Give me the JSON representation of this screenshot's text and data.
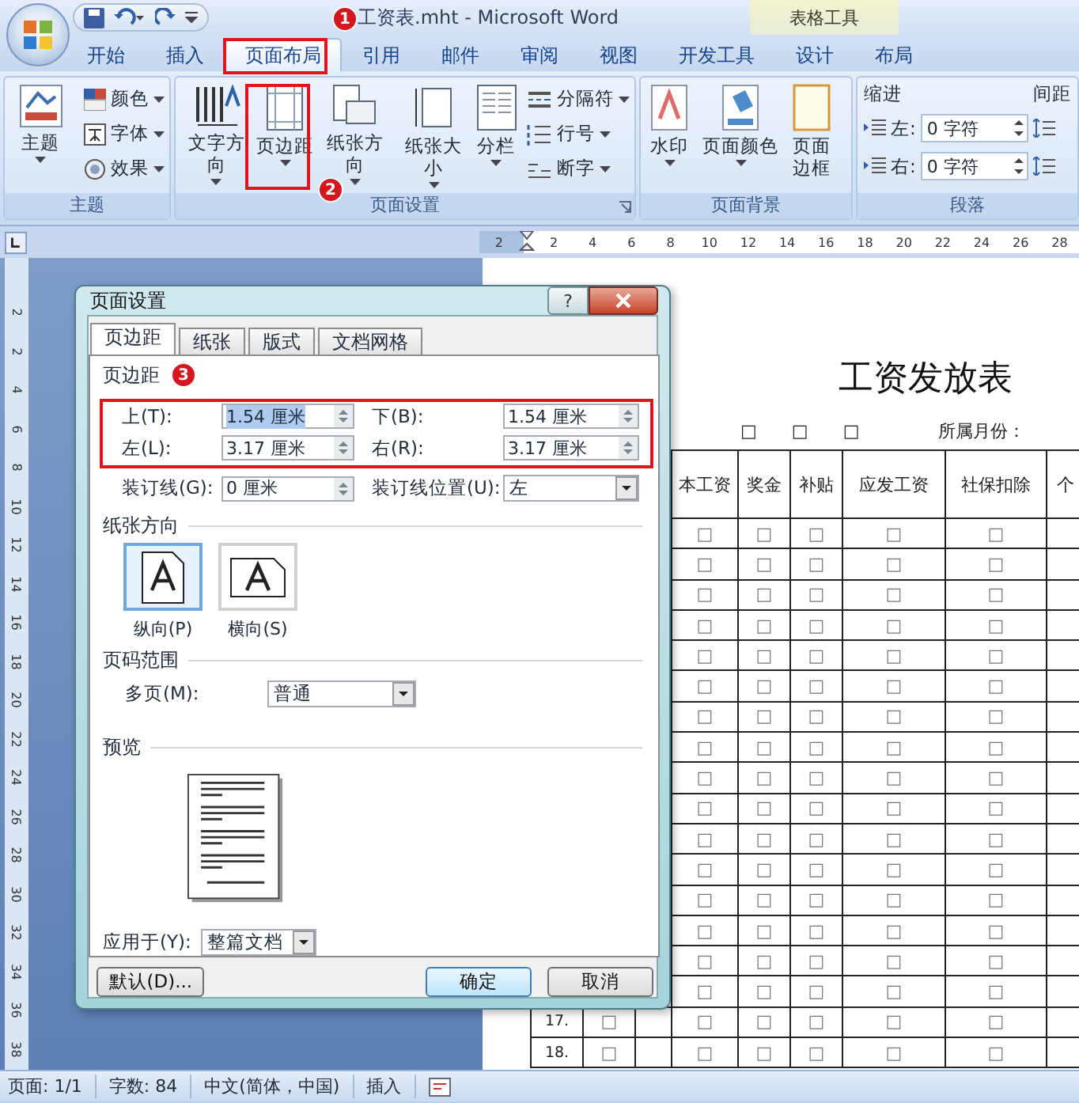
{
  "title_bar": {
    "title": "工资表.mht - Microsoft Word",
    "context_group": "表格工具"
  },
  "ribbon_tabs": [
    {
      "label": "开始",
      "selected": false
    },
    {
      "label": "插入",
      "selected": false
    },
    {
      "label": "页面布局",
      "selected": true
    },
    {
      "label": "引用",
      "selected": false
    },
    {
      "label": "邮件",
      "selected": false
    },
    {
      "label": "审阅",
      "selected": false
    },
    {
      "label": "视图",
      "selected": false
    },
    {
      "label": "开发工具",
      "selected": false
    },
    {
      "label": "设计",
      "selected": false
    },
    {
      "label": "布局",
      "selected": false
    }
  ],
  "ribbon_groups": [
    {
      "kind": "buttons",
      "title": "主题",
      "launcher": false,
      "large": [
        {
          "label": "主题",
          "dropdown": true
        }
      ],
      "small": [
        {
          "label": "颜色"
        },
        {
          "label": "字体"
        },
        {
          "label": "效果"
        }
      ]
    },
    {
      "kind": "buttons",
      "title": "页面设置",
      "launcher": true,
      "large": [
        {
          "label": "文字方向",
          "dropdown": true
        },
        {
          "label": "页边距",
          "dropdown": true
        },
        {
          "label": "纸张方向",
          "dropdown": true
        },
        {
          "label": "纸张大小",
          "dropdown": true
        },
        {
          "label": "分栏",
          "dropdown": true
        }
      ],
      "small": [
        {
          "label": "分隔符"
        },
        {
          "label": "行号"
        },
        {
          "label": "断字"
        }
      ]
    },
    {
      "kind": "buttons",
      "title": "页面背景",
      "launcher": false,
      "large": [
        {
          "label": "水印",
          "dropdown": true
        },
        {
          "label": "页面颜色",
          "dropdown": true
        },
        {
          "label": "页面边框",
          "dropdown": false
        }
      ]
    },
    {
      "kind": "paragraph",
      "title": "段落",
      "indent_label": "缩进",
      "indent_fields": [
        {
          "label": "左:",
          "value": "0 字符"
        },
        {
          "label": "右:",
          "value": "0 字符"
        }
      ],
      "spacing_label": "间距"
    }
  ],
  "ruler": {
    "marks": [
      "2",
      "2",
      "4",
      "6",
      "8",
      "10",
      "12",
      "14",
      "16",
      "18",
      "20",
      "22",
      "24",
      "26",
      "28"
    ]
  },
  "vertical_ruler": {
    "marks": [
      "2",
      "2",
      "4",
      "6",
      "8",
      "10",
      "12",
      "14",
      "16",
      "18",
      "20",
      "22",
      "24",
      "26",
      "28",
      "30",
      "32",
      "34",
      "36",
      "38"
    ]
  },
  "document": {
    "title": "工资发放表",
    "header_marks": [
      "□",
      "□",
      "□"
    ],
    "month_label": "所属月份：",
    "table": {
      "columns": [
        "本工资",
        "奖金",
        "补贴",
        "应发工资",
        "社保扣除",
        "个"
      ],
      "rows": [
        {
          "cells": [
            "□",
            "□",
            "□",
            "□",
            "□"
          ]
        },
        {
          "cells": [
            "□",
            "□",
            "□",
            "□",
            "□"
          ]
        },
        {
          "cells": [
            "□",
            "□",
            "□",
            "□",
            "□"
          ]
        },
        {
          "cells": [
            "□",
            "□",
            "□",
            "□",
            "□"
          ]
        },
        {
          "cells": [
            "□",
            "□",
            "□",
            "□",
            "□"
          ]
        },
        {
          "cells": [
            "□",
            "□",
            "□",
            "□",
            "□"
          ]
        },
        {
          "cells": [
            "□",
            "□",
            "□",
            "□",
            "□"
          ]
        },
        {
          "cells": [
            "□",
            "□",
            "□",
            "□",
            "□"
          ]
        },
        {
          "cells": [
            "□",
            "□",
            "□",
            "□",
            "□"
          ]
        },
        {
          "cells": [
            "□",
            "□",
            "□",
            "□",
            "□"
          ]
        },
        {
          "cells": [
            "□",
            "□",
            "□",
            "□",
            "□"
          ]
        },
        {
          "cells": [
            "□",
            "□",
            "□",
            "□",
            "□"
          ]
        },
        {
          "cells": [
            "□",
            "□",
            "□",
            "□",
            "□"
          ]
        },
        {
          "cells": [
            "□",
            "□",
            "□",
            "□",
            "□"
          ]
        },
        {
          "cells": [
            "□",
            "□",
            "□",
            "□",
            "□"
          ]
        },
        {
          "cells": [
            "□",
            "□",
            "□",
            "□",
            "□"
          ]
        },
        {
          "number": "17.",
          "mark": "□",
          "cells": [
            "□",
            "□",
            "□",
            "□",
            "□"
          ]
        },
        {
          "number": "18.",
          "mark": "□",
          "cells": [
            "□",
            "□",
            "□",
            "□",
            "□"
          ]
        }
      ]
    }
  },
  "dialog": {
    "title": "页面设置",
    "help_button": "?",
    "tabs": [
      {
        "label": "页边距",
        "selected": true
      },
      {
        "label": "纸张",
        "selected": false
      },
      {
        "label": "版式",
        "selected": false
      },
      {
        "label": "文档网格",
        "selected": false
      }
    ],
    "margins_heading": "页边距",
    "margin_fields": [
      {
        "label": "上(T):",
        "value": "1.54 厘米",
        "highlighted": true
      },
      {
        "label": "下(B):",
        "value": "1.54 厘米",
        "highlighted": false
      },
      {
        "label": "左(L):",
        "value": "3.17 厘米",
        "highlighted": false
      },
      {
        "label": "右(R):",
        "value": "3.17 厘米",
        "highlighted": false
      }
    ],
    "gutter": {
      "label": "装订线(G):",
      "value": "0 厘米"
    },
    "gutter_position": {
      "label": "装订线位置(U):",
      "value": "左"
    },
    "orientation_heading": "纸张方向",
    "orientations": [
      {
        "kind": "portrait",
        "label": "纵向(P)",
        "selected": true
      },
      {
        "kind": "landscape",
        "label": "横向(S)",
        "selected": false
      }
    ],
    "pages_heading": "页码范围",
    "multiple_pages": {
      "label": "多页(M):",
      "value": "普通"
    },
    "preview_heading": "预览",
    "apply_to": {
      "label": "应用于(Y):",
      "value": "整篇文档"
    },
    "buttons": [
      {
        "label": "默认(D)...",
        "default": false
      },
      {
        "label": "确定",
        "default": true
      },
      {
        "label": "取消",
        "default": false
      }
    ]
  },
  "annotations": [
    {
      "label": "1"
    },
    {
      "label": "2"
    },
    {
      "label": "3"
    }
  ],
  "status_bar": {
    "items": [
      "页面: 1/1",
      "字数: 84",
      "中文(简体，中国)",
      "插入"
    ]
  }
}
